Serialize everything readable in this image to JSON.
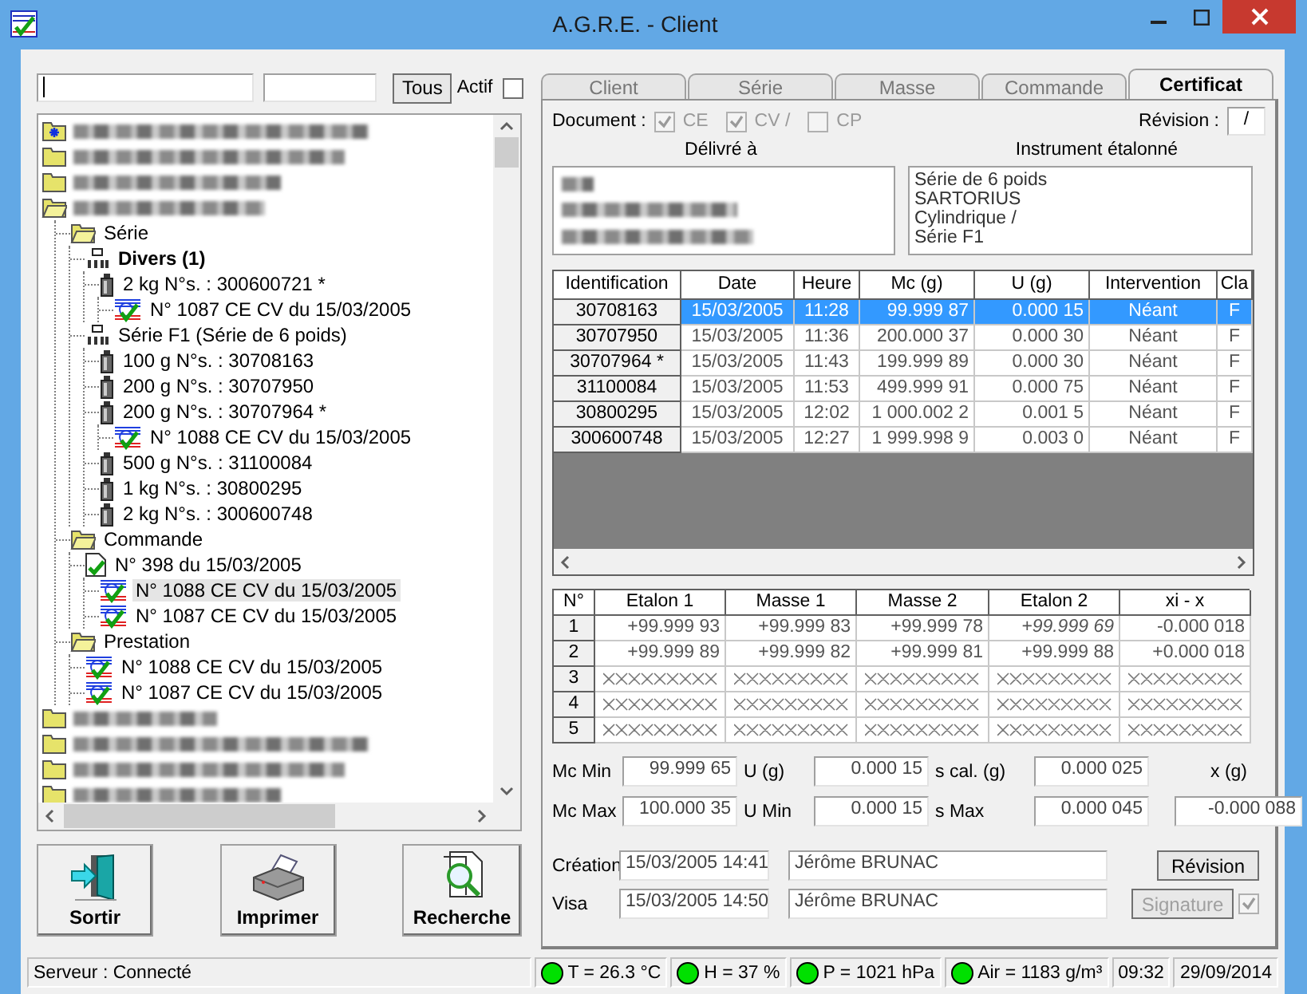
{
  "window": {
    "title": "A.G.R.E. - Client"
  },
  "filter": {
    "all_button": "Tous",
    "active_label": "Actif",
    "active_checked": false
  },
  "tree": [
    {
      "kind": "star-folder",
      "selected": false
    },
    {
      "kind": "folder",
      "selected": false
    },
    {
      "kind": "folder",
      "selected": false
    },
    {
      "kind": "open-folder",
      "selected": false,
      "children": [
        {
          "label": "Série",
          "kind": "open-folder",
          "selected": false,
          "children": [
            {
              "label": "Divers (1)",
              "kind": "weights-set",
              "bold": true,
              "selected": false,
              "children": [
                {
                  "label": "2 kg N°s. : 300600721 *",
                  "kind": "weight",
                  "selected": false,
                  "children": [
                    {
                      "label": "N° 1087 CE CV du 15/03/2005",
                      "kind": "certificate",
                      "selected": false
                    }
                  ]
                }
              ]
            },
            {
              "label": "Série F1 (Série de 6 poids)",
              "kind": "weights-set",
              "selected": false,
              "children": [
                {
                  "label": "100 g N°s. : 30708163",
                  "kind": "weight",
                  "selected": false
                },
                {
                  "label": "200 g N°s. : 30707950",
                  "kind": "weight",
                  "selected": false
                },
                {
                  "label": "200 g N°s. : 30707964 *",
                  "kind": "weight",
                  "selected": false,
                  "children": [
                    {
                      "label": "N° 1088 CE CV du 15/03/2005",
                      "kind": "certificate",
                      "selected": false
                    }
                  ]
                },
                {
                  "label": "500 g N°s. : 31100084",
                  "kind": "weight",
                  "selected": false
                },
                {
                  "label": "1 kg N°s. : 30800295",
                  "kind": "weight",
                  "selected": false
                },
                {
                  "label": "2 kg N°s. : 300600748",
                  "kind": "weight",
                  "selected": false
                }
              ]
            }
          ]
        },
        {
          "label": "Commande",
          "kind": "open-folder",
          "selected": false,
          "children": [
            {
              "label": "N° 398 du 15/03/2005",
              "kind": "order",
              "selected": false,
              "children": [
                {
                  "label": "N° 1088 CE CV du 15/03/2005",
                  "kind": "certificate",
                  "selected": true
                },
                {
                  "label": "N° 1087 CE CV du 15/03/2005",
                  "kind": "certificate",
                  "selected": false
                }
              ]
            }
          ]
        },
        {
          "label": "Prestation",
          "kind": "open-folder",
          "selected": false,
          "children": [
            {
              "label": "N° 1088 CE CV du 15/03/2005",
              "kind": "certificate",
              "selected": false
            },
            {
              "label": "N° 1087 CE CV du 15/03/2005",
              "kind": "certificate",
              "selected": false
            }
          ]
        }
      ]
    },
    {
      "kind": "folder",
      "selected": false
    },
    {
      "kind": "folder",
      "selected": false
    },
    {
      "kind": "folder",
      "selected": false
    },
    {
      "kind": "folder",
      "selected": false
    }
  ],
  "buttons": [
    {
      "label": "Sortir",
      "kind": "exit"
    },
    {
      "label": "Imprimer",
      "kind": "printer"
    },
    {
      "label": "Recherche",
      "kind": "search"
    }
  ],
  "tabs": [
    {
      "label": "Client",
      "selected": false
    },
    {
      "label": "Série",
      "selected": false
    },
    {
      "label": "Masse",
      "selected": false
    },
    {
      "label": "Commande",
      "selected": false
    },
    {
      "label": "Certificat",
      "selected": true
    }
  ],
  "document": {
    "label": "Document :",
    "options": [
      {
        "label": "CE",
        "checked": true
      },
      {
        "label": "CV /",
        "checked": true
      },
      {
        "label": "CP",
        "checked": false
      }
    ],
    "revision_label": "Révision :",
    "revision": "/"
  },
  "delivered_to": {
    "label": "Délivré à",
    "lines": [
      {
        "kind": "redacted"
      },
      {
        "kind": "redacted"
      },
      {
        "kind": "redacted"
      }
    ]
  },
  "instrument": {
    "label": "Instrument étalonné",
    "lines": [
      "Série de 6 poids",
      "SARTORIUS",
      "Cylindrique /",
      "Série F1"
    ]
  },
  "results": {
    "columns": [
      "Identification",
      "Date",
      "Heure",
      "Mc (g)",
      "U (g)",
      "Intervention",
      "Cla"
    ],
    "rows": [
      {
        "cells": [
          "30708163",
          "15/03/2005",
          "11:28",
          "99.999 87",
          "0.000 15",
          "Néant",
          "F"
        ],
        "selected": true
      },
      {
        "cells": [
          "30707950",
          "15/03/2005",
          "11:36",
          "200.000 37",
          "0.000 30",
          "Néant",
          "F"
        ],
        "selected": false
      },
      {
        "cells": [
          "30707964 *",
          "15/03/2005",
          "11:43",
          "199.999 89",
          "0.000 30",
          "Néant",
          "F"
        ],
        "selected": false
      },
      {
        "cells": [
          "31100084",
          "15/03/2005",
          "11:53",
          "499.999 91",
          "0.000 75",
          "Néant",
          "F"
        ],
        "selected": false
      },
      {
        "cells": [
          "30800295",
          "15/03/2005",
          "12:02",
          "1 000.002 2",
          "0.001 5",
          "Néant",
          "F"
        ],
        "selected": false
      },
      {
        "cells": [
          "300600748",
          "15/03/2005",
          "12:27",
          "1 999.998 9",
          "0.003 0",
          "Néant",
          "F"
        ],
        "selected": false
      }
    ]
  },
  "weighings": {
    "columns": [
      "N°",
      "Etalon 1",
      "Masse 1",
      "Masse 2",
      "Etalon 2",
      "xi - x"
    ],
    "rows": [
      {
        "n": "1",
        "filled": true,
        "cells": [
          {
            "text": "+99.999 93",
            "italic": false
          },
          {
            "text": "+99.999 83",
            "italic": false
          },
          {
            "text": "+99.999 78",
            "italic": false
          },
          {
            "text": "+99.999 69",
            "italic": true
          },
          {
            "text": "-0.000 018",
            "italic": false
          }
        ]
      },
      {
        "n": "2",
        "filled": true,
        "cells": [
          {
            "text": "+99.999 89",
            "italic": false
          },
          {
            "text": "+99.999 82",
            "italic": false
          },
          {
            "text": "+99.999 81",
            "italic": false
          },
          {
            "text": "+99.999 88",
            "italic": false
          },
          {
            "text": "+0.000 018",
            "italic": false
          }
        ]
      },
      {
        "n": "3",
        "filled": false
      },
      {
        "n": "4",
        "filled": false
      },
      {
        "n": "5",
        "filled": false
      }
    ]
  },
  "stats": {
    "mc_min_label": "Mc Min",
    "mc_min": "99.999 65",
    "u_label": "U (g)",
    "u": "0.000 15",
    "s_cal_label": "s cal. (g)",
    "s_cal": "0.000 025",
    "x_label": "x (g)",
    "mc_max_label": "Mc Max",
    "mc_max": "100.000 35",
    "u_min_label": "U Min",
    "u_min": "0.000 15",
    "s_max_label": "s Max",
    "s_max": "0.000 045",
    "x": "-0.000 088"
  },
  "creation": {
    "label": "Création",
    "date": "15/03/2005 14:41",
    "name": "Jérôme BRUNAC",
    "button": "Révision",
    "button_disabled": false
  },
  "visa": {
    "label": "Visa",
    "date": "15/03/2005 14:50",
    "name": "Jérôme BRUNAC",
    "button": "Signature",
    "button_disabled": true,
    "checked": true
  },
  "status_bar": {
    "server": "Serveur : Connecté",
    "indicators": [
      {
        "text": "T = 26.3 °C",
        "color": "#00e000"
      },
      {
        "text": "H = 37 %",
        "color": "#00e000"
      },
      {
        "text": "P = 1021 hPa",
        "color": "#00e000"
      },
      {
        "text": "Air = 1183 g/m³",
        "color": "#00e000"
      }
    ],
    "time": "09:32",
    "date": "29/09/2014"
  }
}
